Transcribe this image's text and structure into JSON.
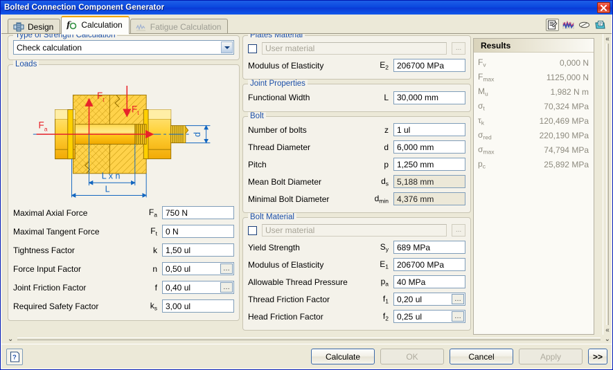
{
  "window": {
    "title": "Bolted Connection Component Generator",
    "close_label": "✕"
  },
  "tabs": [
    {
      "label": "Design",
      "icon": "design-icon",
      "state": "inactive"
    },
    {
      "label": "Calculation",
      "icon": "function-icon",
      "state": "active"
    },
    {
      "label": "Fatigue Calculation",
      "icon": "fatigue-icon",
      "state": "disabled"
    }
  ],
  "toolbar": {
    "icons": [
      {
        "name": "results-properties-icon"
      },
      {
        "name": "graph-icon"
      },
      {
        "name": "eraser-icon"
      },
      {
        "name": "export-icon"
      }
    ]
  },
  "strength_group": {
    "legend": "Type of Strength Calculation",
    "combo_value": "Check calculation",
    "options": [
      "Check calculation"
    ]
  },
  "loads_group": {
    "legend": "Loads",
    "diagram": {
      "labels": {
        "force_tangent_top": "F",
        "force_tangent_top_sub": "t",
        "force_tangent_right": "F",
        "force_tangent_right_sub": "t",
        "force_axial": "F",
        "force_axial_sub": "a",
        "diameter": "d",
        "length_times_n": "L x n",
        "length": "L"
      }
    },
    "fields": [
      {
        "label": "Maximal Axial Force",
        "symbol": "F",
        "sub": "a",
        "value": "750 N",
        "readonly": false,
        "browse": false
      },
      {
        "label": "Maximal Tangent Force",
        "symbol": "F",
        "sub": "t",
        "value": "0 N",
        "readonly": false,
        "browse": false
      },
      {
        "label": "Tightness Factor",
        "symbol": "k",
        "sub": "",
        "value": "1,50 ul",
        "readonly": false,
        "browse": false
      },
      {
        "label": "Force Input Factor",
        "symbol": "n",
        "sub": "",
        "value": "0,50 ul",
        "readonly": false,
        "browse": true
      },
      {
        "label": "Joint Friction Factor",
        "symbol": "f",
        "sub": "",
        "value": "0,40 ul",
        "readonly": false,
        "browse": true
      },
      {
        "label": "Required Safety Factor",
        "symbol": "k",
        "sub": "s",
        "value": "3,00 ul",
        "readonly": false,
        "browse": false
      }
    ]
  },
  "plates_material_group": {
    "legend": "Plates Material",
    "material_placeholder": "User material",
    "material_value": "",
    "browse_label": "...",
    "fields": [
      {
        "label": "Modulus of Elasticity",
        "symbol": "E",
        "sub": "2",
        "value": "206700 MPa",
        "readonly": false,
        "browse": false
      }
    ]
  },
  "joint_properties_group": {
    "legend": "Joint Properties",
    "fields": [
      {
        "label": "Functional Width",
        "symbol": "L",
        "sub": "",
        "value": "30,000 mm",
        "readonly": false,
        "browse": false
      }
    ]
  },
  "bolt_group": {
    "legend": "Bolt",
    "fields": [
      {
        "label": "Number of bolts",
        "symbol": "z",
        "sub": "",
        "value": "1 ul",
        "readonly": false,
        "browse": false
      },
      {
        "label": "Thread Diameter",
        "symbol": "d",
        "sub": "",
        "value": "6,000 mm",
        "readonly": false,
        "browse": false
      },
      {
        "label": "Pitch",
        "symbol": "p",
        "sub": "",
        "value": "1,250 mm",
        "readonly": false,
        "browse": false
      },
      {
        "label": "Mean Bolt Diameter",
        "symbol": "d",
        "sub": "s",
        "value": "5,188 mm",
        "readonly": true,
        "browse": false
      },
      {
        "label": "Minimal Bolt Diameter",
        "symbol": "d",
        "sub": "min",
        "value": "4,376 mm",
        "readonly": true,
        "browse": false
      }
    ]
  },
  "bolt_material_group": {
    "legend": "Bolt Material",
    "material_placeholder": "User material",
    "material_value": "",
    "browse_label": "...",
    "fields": [
      {
        "label": "Yield Strength",
        "symbol": "S",
        "sub": "y",
        "value": "689 MPa",
        "readonly": false,
        "browse": false
      },
      {
        "label": "Modulus of Elasticity",
        "symbol": "E",
        "sub": "1",
        "value": "206700 MPa",
        "readonly": false,
        "browse": false
      },
      {
        "label": "Allowable Thread Pressure",
        "symbol": "p",
        "sub": "a",
        "value": "40 MPa",
        "readonly": false,
        "browse": false
      },
      {
        "label": "Thread Friction Factor",
        "symbol": "f",
        "sub": "1",
        "value": "0,20 ul",
        "readonly": false,
        "browse": true
      },
      {
        "label": "Head Friction Factor",
        "symbol": "f",
        "sub": "2",
        "value": "0,25 ul",
        "readonly": false,
        "browse": true
      }
    ]
  },
  "results": {
    "title": "Results",
    "rows": [
      {
        "symbol": "F",
        "sub": "v",
        "value": "0,000 N"
      },
      {
        "symbol": "F",
        "sub": "max",
        "value": "1125,000 N"
      },
      {
        "symbol": "M",
        "sub": "u",
        "value": "1,982 N m"
      },
      {
        "symbol": "σ",
        "sub": "t",
        "value": "70,324 MPa"
      },
      {
        "symbol": "τ",
        "sub": "k",
        "value": "120,469 MPa"
      },
      {
        "symbol": "σ",
        "sub": "red",
        "value": "220,190 MPa"
      },
      {
        "symbol": "σ",
        "sub": "max",
        "value": "74,794 MPa"
      },
      {
        "symbol": "p",
        "sub": "c",
        "value": "25,892 MPa"
      }
    ]
  },
  "splitters": {
    "vertical_collapse": "«",
    "horizontal_collapse": "⌄"
  },
  "bottom_bar": {
    "help_label": "?",
    "buttons": [
      {
        "label": "Calculate",
        "state": "enabled"
      },
      {
        "label": "OK",
        "state": "disabled"
      },
      {
        "label": "Cancel",
        "state": "enabled"
      },
      {
        "label": "Apply",
        "state": "disabled"
      },
      {
        "label": ">>",
        "state": "enabled"
      }
    ]
  },
  "colors": {
    "title_blue": "#0a46de",
    "legend_blue": "#1b4fa8",
    "active_tab_accent": "#f2a400",
    "dialog_face": "#ece9d8",
    "readonly_field": "#ece8d8",
    "results_text": "#8d8a7e",
    "diagram_gold": "#ffcc33",
    "diagram_red": "#e8232a",
    "diagram_blue": "#1266c0"
  }
}
